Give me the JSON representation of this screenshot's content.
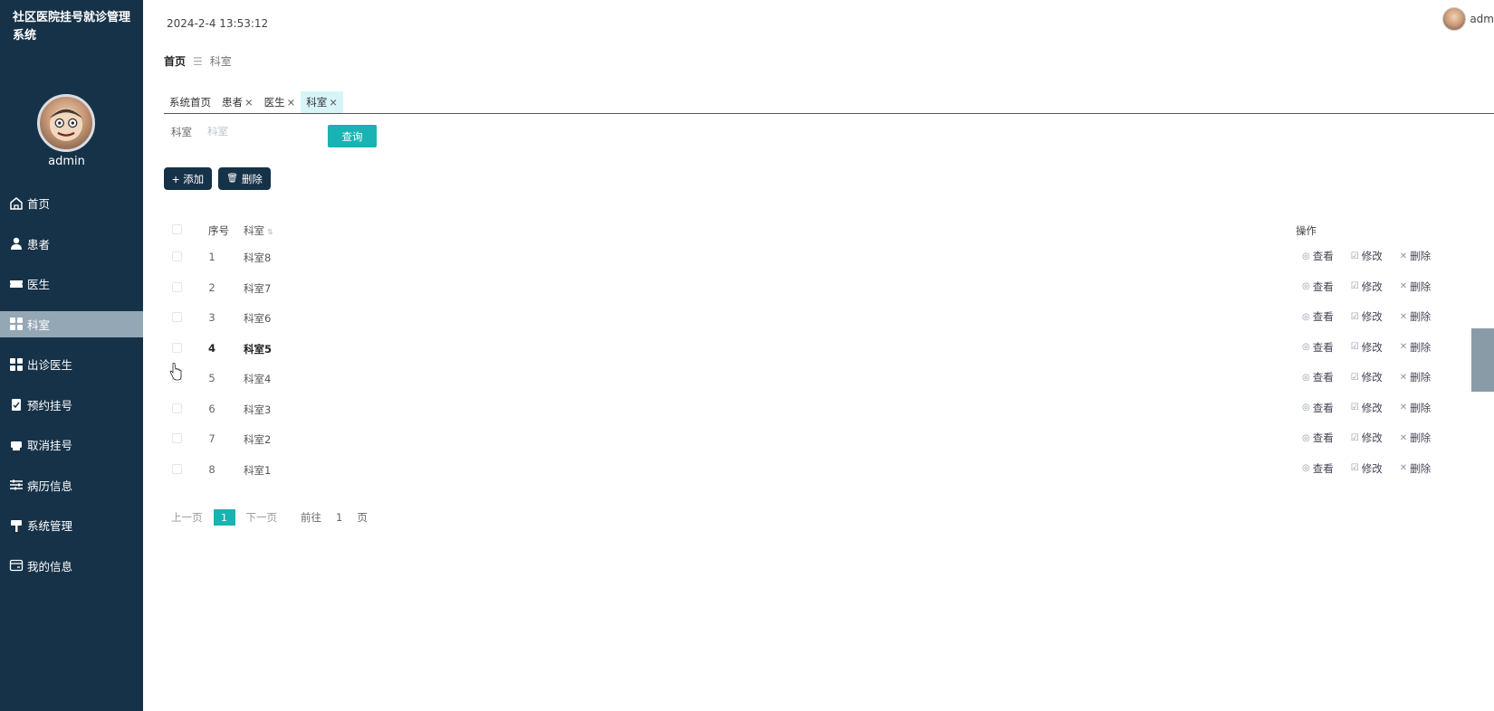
{
  "sidebar": {
    "title": "社区医院挂号就诊管理系统",
    "username": "admin",
    "items": [
      {
        "label": "首页",
        "icon": "home-icon"
      },
      {
        "label": "患者",
        "icon": "user-icon"
      },
      {
        "label": "医生",
        "icon": "ticket-icon"
      },
      {
        "label": "科室",
        "icon": "grid-icon",
        "active": true
      },
      {
        "label": "出诊医生",
        "icon": "grid-icon"
      },
      {
        "label": "预约挂号",
        "icon": "clipboard-icon"
      },
      {
        "label": "取消挂号",
        "icon": "printer-icon"
      },
      {
        "label": "病历信息",
        "icon": "sliders-icon"
      },
      {
        "label": "系统管理",
        "icon": "brush-icon"
      },
      {
        "label": "我的信息",
        "icon": "card-icon"
      }
    ]
  },
  "header": {
    "datetime": "2024-2-4 13:53:12",
    "user": "adm"
  },
  "breadcrumb": {
    "home": "首页",
    "sep": "☰",
    "current": "科室"
  },
  "tabs": [
    {
      "label": "系统首页",
      "closable": false
    },
    {
      "label": "患者",
      "closable": true
    },
    {
      "label": "医生",
      "closable": true
    },
    {
      "label": "科室",
      "closable": true,
      "active": true
    }
  ],
  "tab_close": "×",
  "search": {
    "label": "科室",
    "placeholder": "科室",
    "button": "查询"
  },
  "toolbar": {
    "add": "添加",
    "add_icon": "+",
    "delete": "删除",
    "delete_icon": "🗑"
  },
  "table": {
    "headers": {
      "index": "序号",
      "name": "科室",
      "ops": "操作"
    },
    "sort_icon": "⇅",
    "rows": [
      {
        "index": "1",
        "name": "科室8"
      },
      {
        "index": "2",
        "name": "科室7"
      },
      {
        "index": "3",
        "name": "科室6"
      },
      {
        "index": "4",
        "name": "科室5",
        "hover": true
      },
      {
        "index": "5",
        "name": "科室4"
      },
      {
        "index": "6",
        "name": "科室3"
      },
      {
        "index": "7",
        "name": "科室2"
      },
      {
        "index": "8",
        "name": "科室1"
      }
    ],
    "ops": {
      "view": "查看",
      "edit": "修改",
      "delete": "删除"
    },
    "op_icons": {
      "view": "◎",
      "edit": "☑",
      "delete": "✕"
    }
  },
  "pager": {
    "prev": "上一页",
    "current": "1",
    "next": "下一页",
    "goto": "前往",
    "goto_value": "1",
    "unit": "页"
  },
  "colors": {
    "sidebar": "#163248",
    "accent": "#19b3b4",
    "active_menu": "#94a7b5"
  }
}
